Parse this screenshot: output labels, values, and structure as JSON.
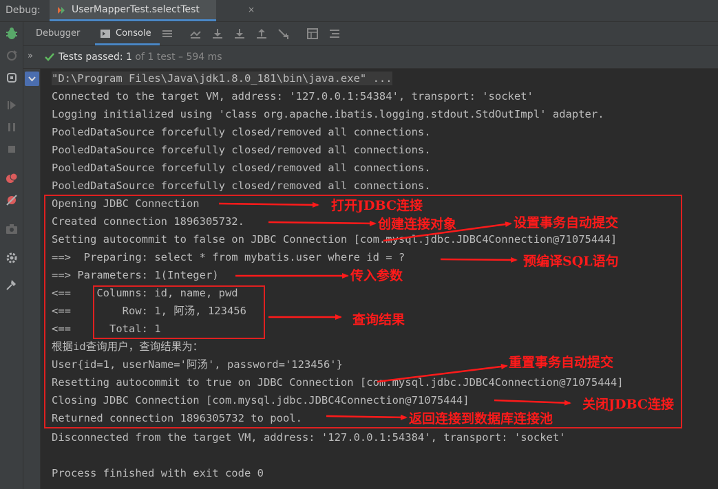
{
  "topbar": {
    "debug_label": "Debug:",
    "run_tab_title": "UserMapperTest.selectTest",
    "close_glyph": "×"
  },
  "toolbar": {
    "debugger_tab": "Debugger",
    "console_tab": "Console"
  },
  "status": {
    "expand_glyph": "»",
    "passed_text": "Tests passed: 1",
    "of_text": " of 1 test – 594 ms"
  },
  "console": {
    "lines": [
      "\"D:\\Program Files\\Java\\jdk1.8.0_181\\bin\\java.exe\" ...",
      "Connected to the target VM, address: '127.0.0.1:54384', transport: 'socket'",
      "Logging initialized using 'class org.apache.ibatis.logging.stdout.StdOutImpl' adapter.",
      "PooledDataSource forcefully closed/removed all connections.",
      "PooledDataSource forcefully closed/removed all connections.",
      "PooledDataSource forcefully closed/removed all connections.",
      "PooledDataSource forcefully closed/removed all connections.",
      "Opening JDBC Connection",
      "Created connection 1896305732.",
      "Setting autocommit to false on JDBC Connection [com.mysql.jdbc.JDBC4Connection@71075444]",
      "==>  Preparing: select * from mybatis.user where id = ?",
      "==> Parameters: 1(Integer)",
      "<==    Columns: id, name, pwd",
      "<==        Row: 1, 阿汤, 123456",
      "<==      Total: 1",
      "根据id查询用户，查询结果为：",
      "User{id=1, userName='阿汤', password='123456'}",
      "Resetting autocommit to true on JDBC Connection [com.mysql.jdbc.JDBC4Connection@71075444]",
      "Closing JDBC Connection [com.mysql.jdbc.JDBC4Connection@71075444]",
      "Returned connection 1896305732 to pool.",
      "Disconnected from the target VM, address: '127.0.0.1:54384', transport: 'socket'",
      "",
      "Process finished with exit code 0"
    ]
  },
  "annotations": {
    "open_jdbc": "打开JDBC连接",
    "create_conn": "创建连接对象",
    "set_autocommit": "设置事务自动提交",
    "precompile_sql": "预编译SQL语句",
    "pass_params": "传入参数",
    "query_result": "查询结果",
    "reset_autocommit": "重置事务自动提交",
    "close_jdbc": "关闭JDBC连接",
    "return_pool": "返回连接到数据库连接池"
  },
  "colors": {
    "accent": "#4a88c7",
    "annotation_red": "#ff1a1a",
    "pass_green": "#5fb85f",
    "background": "#2b2b2b"
  },
  "icons": {
    "left_toolbar": [
      "bug-icon",
      "rerun-icon",
      "rerun-failed-icon",
      "resume-icon",
      "pause-icon",
      "stop-icon",
      "breakpoints-icon",
      "mute-breakpoints-icon",
      "camera-icon",
      "settings-icon",
      "pin-icon"
    ],
    "debug_toolbar": [
      "menu-icon",
      "show-execution-point-icon",
      "step-over-icon",
      "step-into-icon",
      "force-step-into-icon",
      "step-out-icon",
      "run-to-cursor-icon",
      "evaluate-expression-icon",
      "trace-icon"
    ]
  }
}
